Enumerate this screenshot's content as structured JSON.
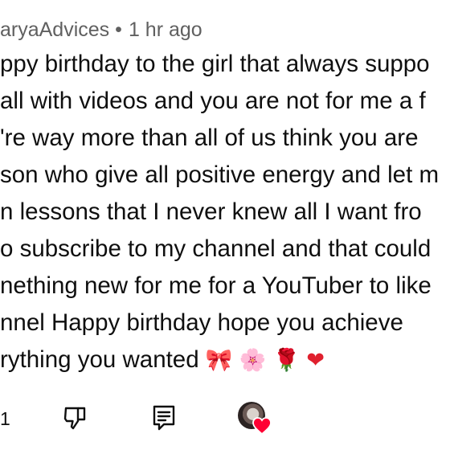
{
  "header": {
    "author": "aryaAdvices",
    "separator": "•",
    "time": "1 hr ago"
  },
  "comment": {
    "lines": [
      "ppy birthday to the girl that always suppo",
      "all with  videos and you are not for me a f",
      "'re way more than all of us think you are",
      "son who give all positive energy and let m",
      "n lessons that I never knew all I want fro",
      "o subscribe to my channel and that could",
      "nething new for me for a YouTuber to like",
      "nnel Happy birthday hope you achieve",
      "rything you wanted"
    ],
    "emojis": [
      "🎀",
      "🌸",
      "🌹",
      "❤"
    ]
  },
  "actions": {
    "like_count": "1",
    "icons": [
      "dislike-icon",
      "reply-comment-icon",
      "creator-heart-avatar"
    ],
    "heart_color": "#ff0033"
  },
  "colors": {
    "text": "#0f0f0f",
    "meta": "#606060",
    "background": "#ffffff"
  }
}
